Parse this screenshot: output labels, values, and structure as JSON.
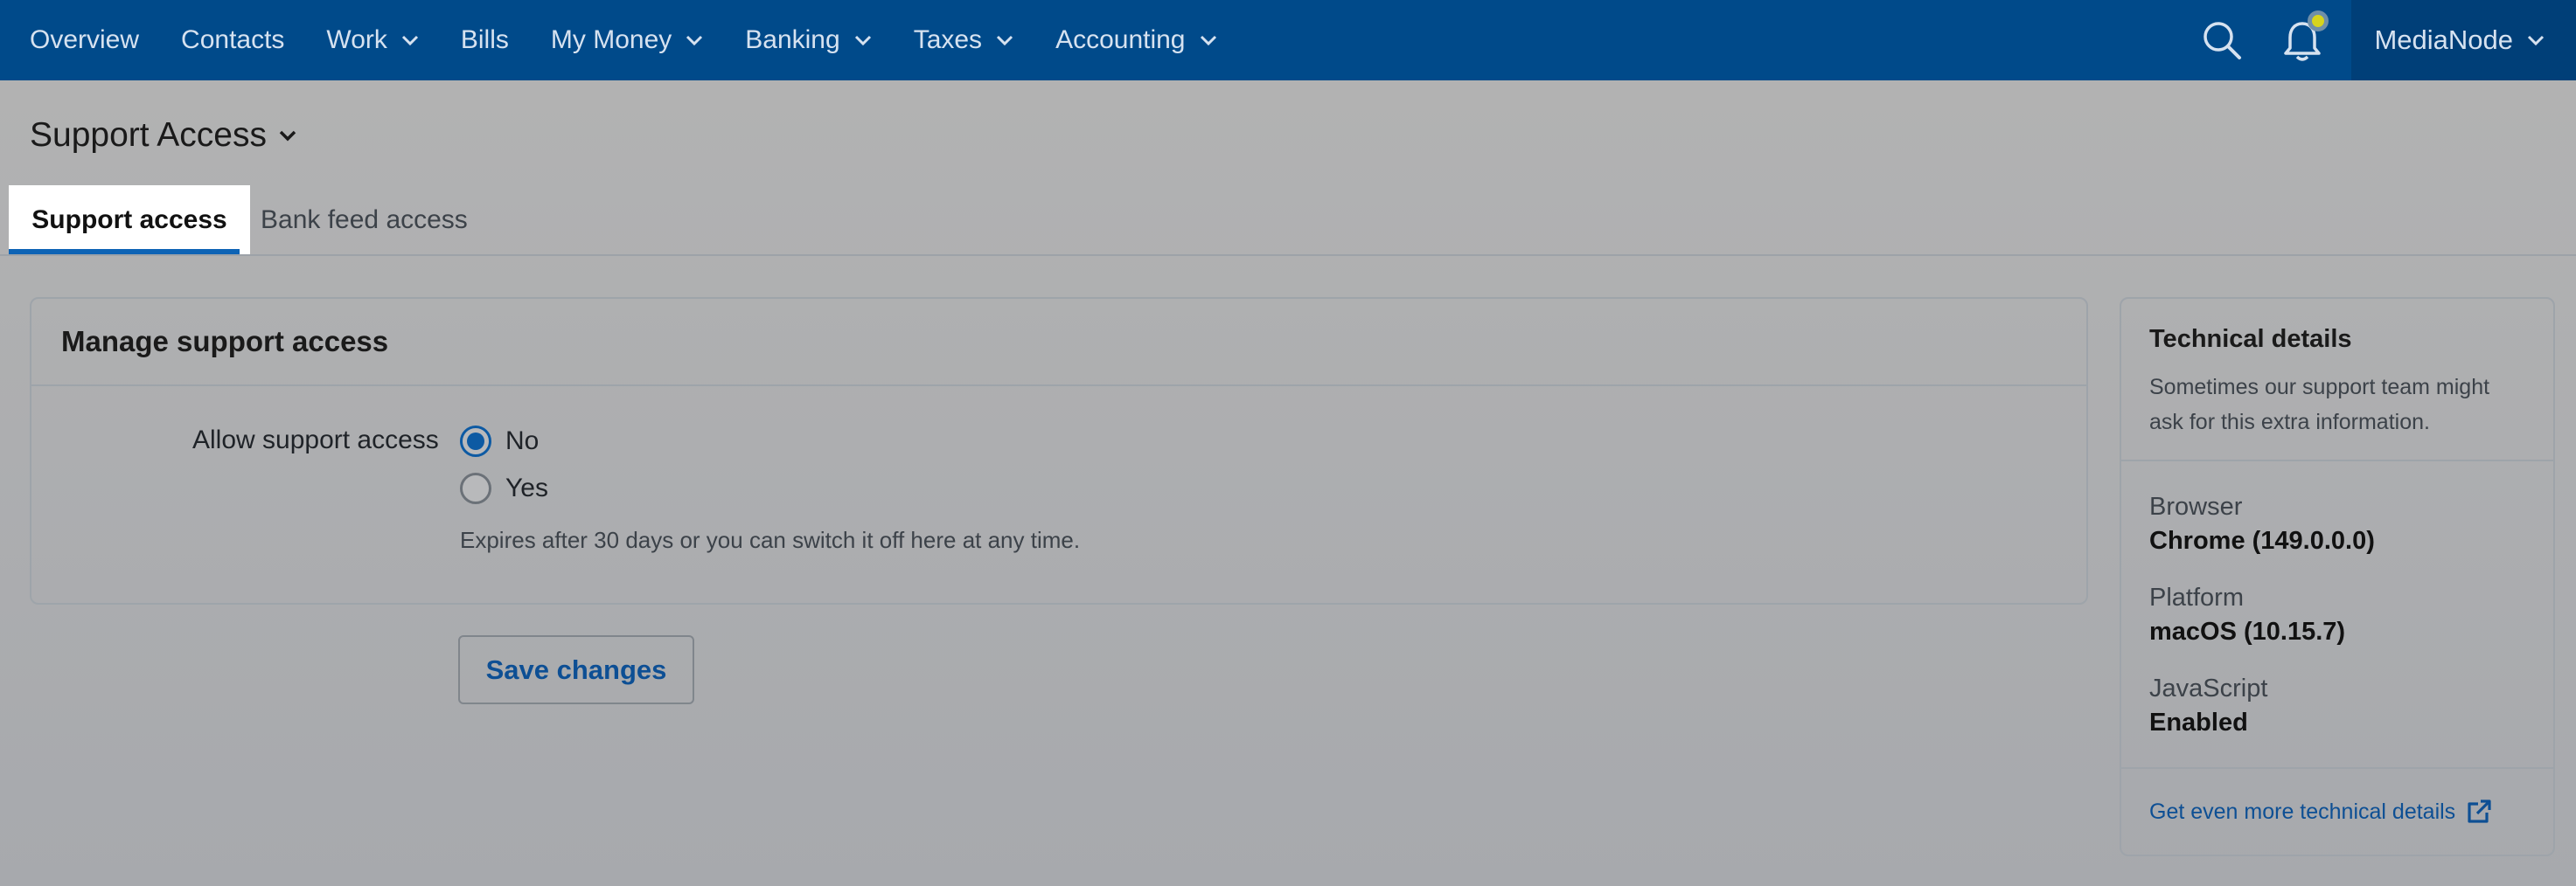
{
  "nav": {
    "items": [
      {
        "label": "Overview",
        "dropdown": false
      },
      {
        "label": "Contacts",
        "dropdown": false
      },
      {
        "label": "Work",
        "dropdown": true
      },
      {
        "label": "Bills",
        "dropdown": false
      },
      {
        "label": "My Money",
        "dropdown": true
      },
      {
        "label": "Banking",
        "dropdown": true
      },
      {
        "label": "Taxes",
        "dropdown": true
      },
      {
        "label": "Accounting",
        "dropdown": true
      }
    ],
    "icons": [
      "search-icon",
      "bell-icon"
    ],
    "organization": "MediaNode"
  },
  "page": {
    "title": "Support Access"
  },
  "tabs": [
    {
      "label": "Support access",
      "active": true
    },
    {
      "label": "Bank feed access",
      "active": false
    }
  ],
  "card": {
    "title": "Manage support access",
    "field_label": "Allow support access",
    "options": [
      {
        "label": "No",
        "checked": true
      },
      {
        "label": "Yes",
        "checked": false
      }
    ],
    "hint": "Expires after 30 days or you can switch it off here at any time."
  },
  "save_button": "Save changes",
  "technical": {
    "title": "Technical details",
    "description": "Sometimes our support team might ask for this extra information.",
    "rows": [
      {
        "label": "Browser",
        "value": "Chrome (149.0.0.0)"
      },
      {
        "label": "Platform",
        "value": "macOS (10.15.7)"
      },
      {
        "label": "JavaScript",
        "value": "Enabled"
      }
    ],
    "link": "Get even more technical details"
  },
  "colors": {
    "nav_bg": "#004a8a",
    "accent": "#0d63b5",
    "link": "#0d4f94"
  }
}
